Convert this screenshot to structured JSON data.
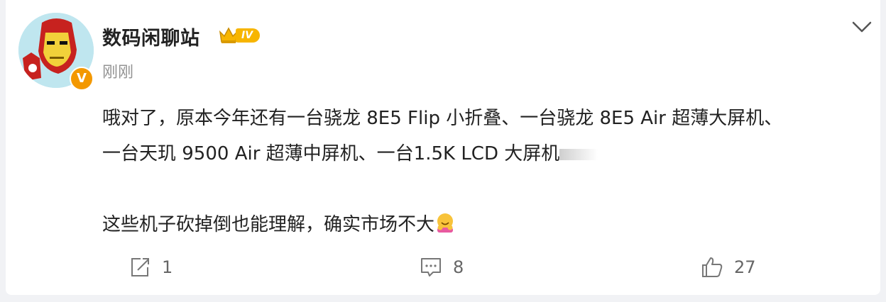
{
  "post": {
    "username": "数码闲聊站",
    "vip_level": "IV",
    "verified_badge": "V",
    "timestamp": "刚刚",
    "text_line1": "哦对了，原本今年还有一台骁龙 8E5 Flip 小折叠、一台骁龙 8E5 Air 超薄大屏机、",
    "text_line2": "一台天玑 9500 Air 超薄中屏机、一台1.5K LCD 大屏机",
    "text_line3": "这些机子砍掉倒也能理解，确实市场不大",
    "emoji": "hug-emoji"
  },
  "actions": {
    "repost_count": "1",
    "comment_count": "8",
    "like_count": "27"
  },
  "icons": [
    "chevron-down-icon",
    "repost-icon",
    "comment-icon",
    "like-icon",
    "crown-icon"
  ],
  "colors": {
    "vip_gold": "#f7b500",
    "verified_orange": "#f39800",
    "text": "#222222",
    "muted": "#939393"
  }
}
